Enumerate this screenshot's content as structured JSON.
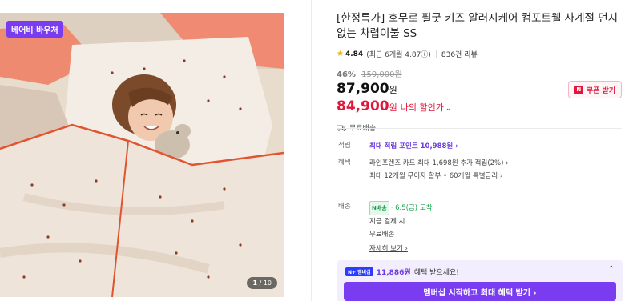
{
  "gallery": {
    "badge": "베어비 바우처",
    "counter_current": "1",
    "counter_total": "/ 10"
  },
  "product": {
    "title": "[한정특가] 호무로 필굿 키즈 알러지케어 컴포트웰 사계절 먼지없는 차렵이불 SS",
    "rating_score": "4.84",
    "rating_recent": "(최근 6개월 4.87ⓘ)",
    "review_count": "836건 리뷰",
    "discount_pct": "46%",
    "original_price": "159,000원",
    "price": "87,900",
    "price_unit": "원",
    "sale_price": "84,900",
    "sale_unit": "원",
    "sale_label": "나의 할인가",
    "coupon_label": "쿠폰 받기",
    "coupon_badge": "N",
    "free_shipping": "무료배송"
  },
  "benefits": {
    "points_key": "적립",
    "points_text": "최대 적립 포인트 10,988원 ›",
    "benefit_key": "혜택",
    "benefit_line1": "라인프렌즈 카드 최대 1,698원 추가 적립(2%) ›",
    "benefit_line2": "최대 12개월 무이자 할부 • 60개월 특별금리 ›"
  },
  "delivery": {
    "key": "배송",
    "badge": "N배송",
    "arrival": "· 6.5(금) 도착",
    "line2": "지금 결제 시",
    "line3": "무료배송",
    "more": "자세히 보기 ›"
  },
  "membership": {
    "badge": "N+ 멤버십",
    "amount": "11,886원",
    "text": "혜택 받으세요!",
    "collapse": "⌃",
    "cta": "멤버십 시작하고 최대 혜택 받기 ›"
  },
  "colors": {
    "accent_purple": "#7a3cf0",
    "sale_red": "#e2163b",
    "delivery_green": "#16a34a"
  }
}
